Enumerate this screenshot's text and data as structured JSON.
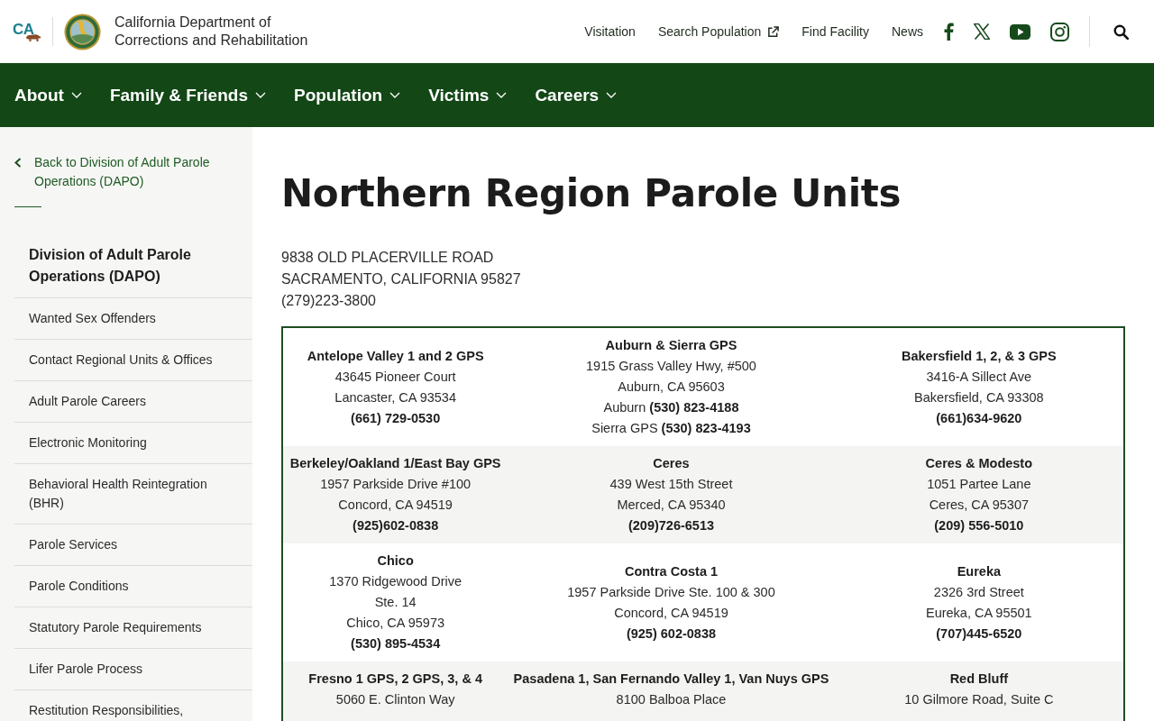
{
  "header": {
    "logo_text": "CA",
    "agency_name": "California Department of Corrections and Rehabilitation",
    "links": [
      {
        "label": "Visitation",
        "external": false
      },
      {
        "label": "Search Population",
        "external": true
      },
      {
        "label": "Find Facility",
        "external": false
      },
      {
        "label": "News",
        "external": false
      }
    ]
  },
  "main_nav": {
    "items": [
      "About",
      "Family & Friends",
      "Population",
      "Victims",
      "Careers"
    ]
  },
  "sidebar": {
    "back_link": "Back to Division of Adult Parole Operations (DAPO)",
    "items": [
      {
        "label": "Division of Adult Parole Operations (DAPO)",
        "selected": true
      },
      {
        "label": "Wanted Sex Offenders",
        "selected": false
      },
      {
        "label": "Contact Regional Units & Offices",
        "selected": false
      },
      {
        "label": "Adult Parole Careers",
        "selected": false
      },
      {
        "label": "Electronic Monitoring",
        "selected": false
      },
      {
        "label": "Behavioral Health Reintegration (BHR)",
        "selected": false
      },
      {
        "label": "Parole Services",
        "selected": false
      },
      {
        "label": "Parole Conditions",
        "selected": false
      },
      {
        "label": "Statutory Parole Requirements",
        "selected": false
      },
      {
        "label": "Lifer Parole Process",
        "selected": false
      },
      {
        "label": "Restitution Responsibilities,",
        "selected": false
      }
    ]
  },
  "page": {
    "title": "Northern Region Parole Units",
    "address_lines": [
      "9838 OLD PLACERVILLE ROAD",
      "SACRAMENTO, CALIFORNIA 95827",
      "(279)223-3800"
    ],
    "units_table": {
      "rows": [
        [
          {
            "name": "Antelope Valley 1 and 2 GPS",
            "lines": [
              "43645 Pioneer Court",
              "Lancaster, CA 93534"
            ],
            "phone": "(661) 729-0530"
          },
          {
            "name": "Auburn & Sierra GPS",
            "lines": [
              "1915 Grass Valley Hwy, #500",
              "Auburn, CA 95603",
              "Auburn **(530) 823-4188**",
              "Sierra GPS **(530) 823-4193**"
            ]
          },
          {
            "name": "Bakersfield 1, 2, & 3 GPS",
            "lines": [
              "3416-A Sillect Ave",
              "Bakersfield, CA 93308"
            ],
            "phone": "(661)634-9620"
          }
        ],
        [
          {
            "name": "Berkeley/Oakland 1/East Bay GPS",
            "lines": [
              "1957 Parkside Drive #100",
              "Concord, CA 94519"
            ],
            "phone": "(925)602-0838"
          },
          {
            "name": "Ceres",
            "lines": [
              "439 West 15th Street",
              "Merced, CA 95340"
            ],
            "phone": "(209)726-6513"
          },
          {
            "name": "Ceres & Modesto",
            "lines": [
              "1051 Partee Lane",
              "Ceres, CA 95307"
            ],
            "phone": "(209) 556-5010"
          }
        ],
        [
          {
            "name": "Chico",
            "lines": [
              "1370 Ridgewood Drive",
              "Ste. 14",
              "Chico, CA 95973"
            ],
            "phone": "(530) 895-4534"
          },
          {
            "name": "Contra Costa 1",
            "lines": [
              "1957 Parkside Drive Ste. 100 & 300",
              "Concord, CA 94519"
            ],
            "phone": "(925) 602-0838"
          },
          {
            "name": "Eureka",
            "lines": [
              "2326 3rd Street",
              "Eureka, CA 95501"
            ],
            "phone": "(707)445-6520"
          }
        ],
        [
          {
            "name": "Fresno 1 GPS, 2 GPS, 3, & 4",
            "lines": [
              "5060 E. Clinton Way"
            ]
          },
          {
            "name": "Pasadena 1, San Fernando Valley 1, Van Nuys GPS",
            "lines": [
              "8100 Balboa Place"
            ]
          },
          {
            "name": "Red Bluff",
            "lines": [
              "10 Gilmore Road, Suite C"
            ]
          }
        ]
      ]
    }
  }
}
